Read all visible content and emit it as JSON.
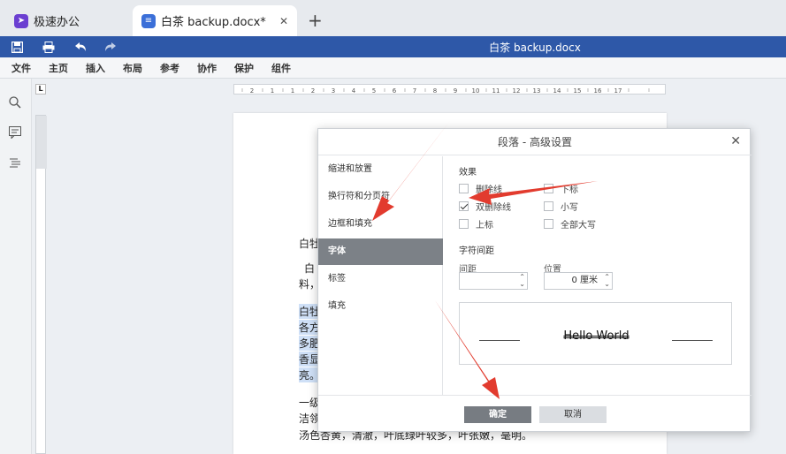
{
  "tabs": [
    {
      "label": "极速办公",
      "icon": "rocket-icon"
    },
    {
      "label": "白茶 backup.docx*",
      "icon": "document-icon"
    }
  ],
  "title_bar": {
    "doc_title": "白茶 backup.docx"
  },
  "menu": [
    "文件",
    "主页",
    "插入",
    "布局",
    "参考",
    "协作",
    "保护",
    "组件"
  ],
  "ruler": {
    "numbers": [
      "2",
      "1",
      "1",
      "2",
      "3",
      "4",
      "5",
      "6",
      "7",
      "8",
      "9",
      "10",
      "11",
      "12",
      "13",
      "14",
      "15",
      "16",
      "17"
    ]
  },
  "document": {
    "lines": [
      "白牡",
      "白",
      "料，",
      "白牡",
      "各方",
      "多肥",
      "香显",
      "亮。",
      "一级",
      "洁领",
      "汤色杏黄，清澈，叶底绿叶较多，叶张嫩，毫明。"
    ]
  },
  "dialog": {
    "title": "段落 - 高级设置",
    "nav": [
      "缩进和放置",
      "换行符和分页符",
      "边框和填充",
      "字体",
      "标签",
      "填充"
    ],
    "active_nav": "字体",
    "effects_label": "效果",
    "effects": [
      {
        "label": "删除线",
        "checked": false
      },
      {
        "label": "下标",
        "checked": false
      },
      {
        "label": "双删除线",
        "checked": true
      },
      {
        "label": "小写",
        "checked": false
      },
      {
        "label": "上标",
        "checked": false
      },
      {
        "label": "全部大写",
        "checked": false
      }
    ],
    "spacing_label": "字符间距",
    "spacing_field_label": "间距",
    "spacing_value": "",
    "position_field_label": "位置",
    "position_value": "0 厘米",
    "preview_text": "Hello World",
    "ok": "确定",
    "cancel": "取消"
  },
  "colors": {
    "title_bar": "#2e58a8",
    "nav_active": "#7c8187",
    "arrow": "#e23b2e"
  }
}
